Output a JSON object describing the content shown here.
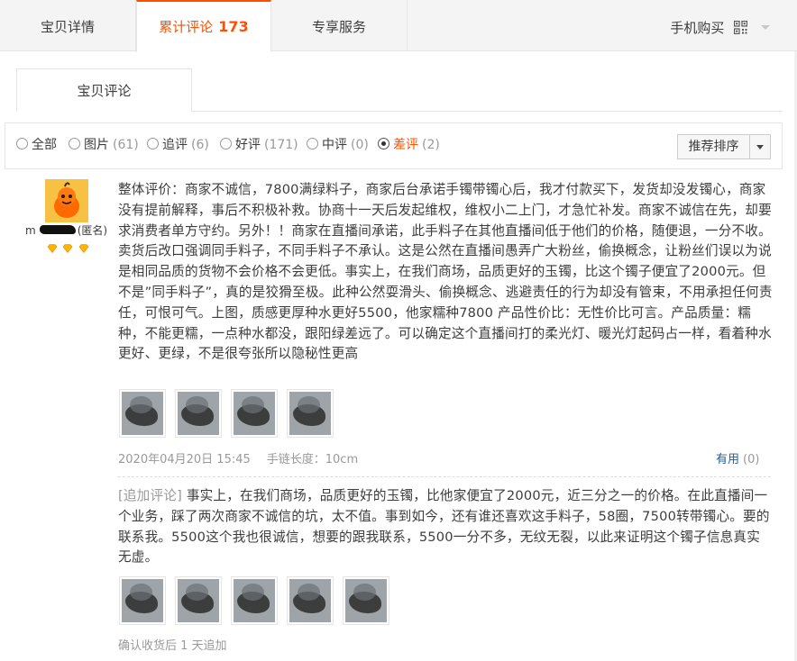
{
  "tabs": [
    {
      "label": "宝贝详情"
    },
    {
      "label": "累计评论",
      "count": "173"
    },
    {
      "label": "专享服务"
    }
  ],
  "mobile_buy": {
    "label": "手机购买",
    "icon": "qr-code-icon"
  },
  "subtab": {
    "label": "宝贝评论"
  },
  "filters": [
    {
      "label": "全部",
      "count": ""
    },
    {
      "label": "图片",
      "count": "(61)"
    },
    {
      "label": "追评",
      "count": "(6)"
    },
    {
      "label": "好评",
      "count": "(171)"
    },
    {
      "label": "中评",
      "count": "(0)"
    },
    {
      "label": "差评",
      "count": "(2)",
      "selected": true
    }
  ],
  "sort": {
    "label": "推荐排序"
  },
  "reviewer": {
    "name_prefix": "m",
    "name_suffix": "(匿名)",
    "avatar_color": "#f7c244",
    "badge_color": "#ffb400"
  },
  "review": {
    "text": "整体评价：商家不诚信，7800满绿料子，商家后台承诺手镯带镯心后，我才付款买下，发货却没发镯心，商家没有提前解释，事后不积极补救。协商十一天后发起维权，维权小二上门，才急忙补发。商家不诚信在先，却要求消费者单方守约。另外！！商家在直播间承诺，此手料子在其他直播间低于他们的价格，随便退，一分不收。卖货后改口强调同手料子，不同手料子不承认。这是公然在直播间愚弄广大粉丝，偷换概念，让粉丝们误以为说是相同品质的货物不会价格不会更低。事实上，在我们商场，品质更好的玉镯，比这个镯子便宜了2000元。但不是”同手料子”，真的是狡猾至极。此种公然耍滑头、偷换概念、逃避责任的行为却没有管束，不用承担任何责任，可恨可气。上图，质感更厚种水更好5500，他家糯种7800 产品性价比：无性价比可言。产品质量：糯种，不能更糯，一点种水都没，跟阳绿差远了。可以确定这个直播间打的柔光灯、暖光灯起码占一样，看着种水更好、更绿，不是很夸张所以隐秘性更高",
    "photo_count": 4,
    "date": "2020年04月20日 15:45",
    "spec": "手链长度：10cm",
    "useful_label": "有用",
    "useful_count": "(0)"
  },
  "append": {
    "tag": "[追加评论]",
    "text": "事实上，在我们商场，品质更好的玉镯，比他家便宜了2000元，近三分之一的价格。在此直播间一个业务，踩了两次商家不诚信的坑，太不值。事到如今，还有谁还喜欢这手料子，58圈，7500转带镯心。要的联系我。5500这个我也很诚信，想要的跟我联系，5500一分不多，无纹无裂，以此来证明这个镯子信息真实无虚。",
    "photo_count": 5,
    "meta": "确认收货后 1 天追加"
  },
  "colors": {
    "accent": "#ff5000",
    "link": "#1f5ea8",
    "muted": "#999999"
  }
}
